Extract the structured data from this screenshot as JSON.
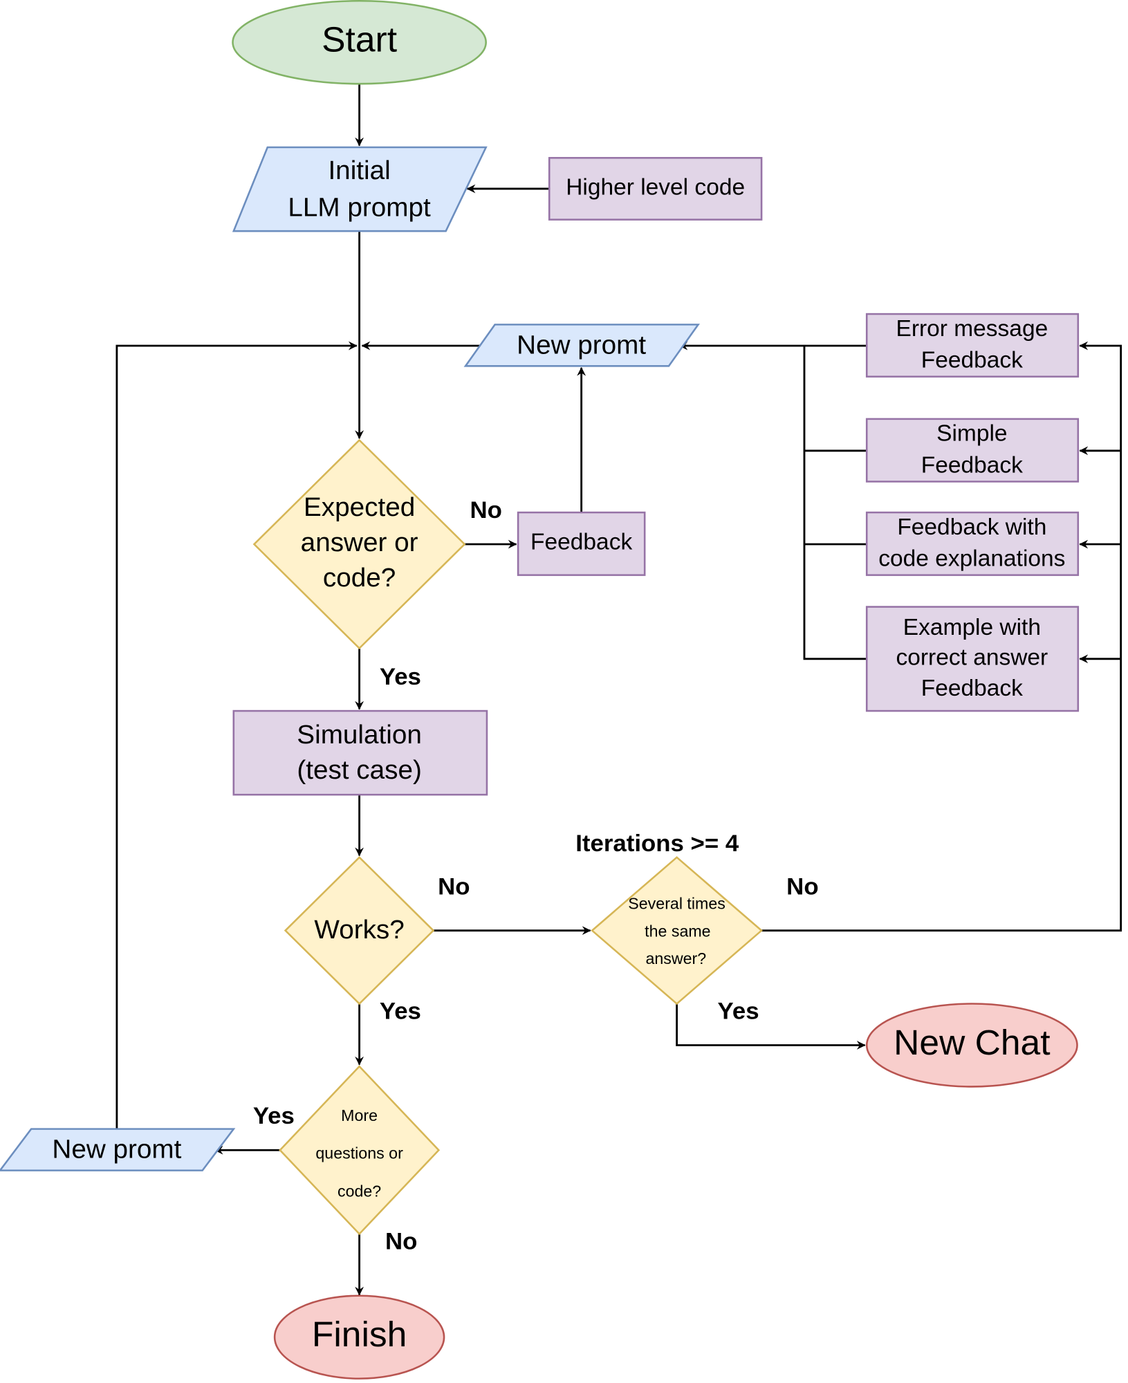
{
  "colors": {
    "terminal_start": {
      "fill": "#d5e8d4",
      "stroke": "#82b366"
    },
    "io": {
      "fill": "#dae8fc",
      "stroke": "#6c8ebf"
    },
    "process": {
      "fill": "#e1d5e7",
      "stroke": "#9673a6"
    },
    "decision": {
      "fill": "#fff2cc",
      "stroke": "#d6b656"
    },
    "terminal_end": {
      "fill": "#f8cecc",
      "stroke": "#b85450"
    }
  },
  "nodes": {
    "start": "Start",
    "initial_prompt": [
      "Initial",
      "LLM prompt"
    ],
    "higher_level_code": "Higher level code",
    "new_prompt_top": "New promt",
    "error_feedback": [
      "Error message",
      "Feedback"
    ],
    "simple_feedback": [
      "Simple",
      "Feedback"
    ],
    "code_feedback": [
      "Feedback with",
      "code explanations"
    ],
    "example_feedback": [
      "Example with",
      "correct answer",
      "Feedback"
    ],
    "expected_decision": [
      "Expected",
      "answer or",
      "code?"
    ],
    "feedback": "Feedback",
    "simulation": [
      "Simulation",
      "(test case)"
    ],
    "works_decision": "Works?",
    "same_answer_decision": [
      "Several times",
      "the same",
      "answer?"
    ],
    "new_chat": "New Chat",
    "more_decision": [
      "More",
      "questions or",
      "code?"
    ],
    "new_prompt_bottom": "New promt",
    "finish": "Finish"
  },
  "edge_labels": {
    "expected_no": "No",
    "expected_yes": "Yes",
    "works_no": "No",
    "works_yes": "Yes",
    "iterations": "Iterations >= 4",
    "same_no": "No",
    "same_yes": "Yes",
    "more_yes": "Yes",
    "more_no": "No"
  }
}
